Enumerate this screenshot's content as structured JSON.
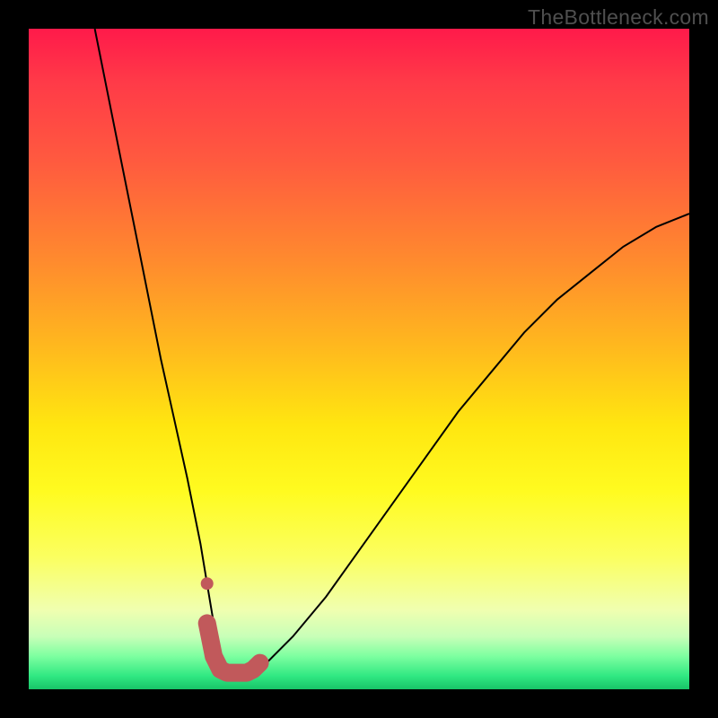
{
  "watermark": "TheBottleneck.com",
  "chart_data": {
    "type": "line",
    "title": "",
    "xlabel": "",
    "ylabel": "",
    "xlim": [
      0,
      100
    ],
    "ylim": [
      0,
      100
    ],
    "series": [
      {
        "name": "black-v-curve",
        "x": [
          10,
          12,
          14,
          16,
          18,
          20,
          22,
          24,
          26,
          27,
          28,
          29,
          30,
          31,
          32,
          34,
          36,
          40,
          45,
          50,
          55,
          60,
          65,
          70,
          75,
          80,
          85,
          90,
          95,
          100
        ],
        "y": [
          100,
          90,
          80,
          70,
          60,
          50,
          41,
          32,
          22,
          16,
          10,
          5,
          2.5,
          2.5,
          2.5,
          2.5,
          4,
          8,
          14,
          21,
          28,
          35,
          42,
          48,
          54,
          59,
          63,
          67,
          70,
          72
        ]
      },
      {
        "name": "red-floor-segment",
        "x": [
          27,
          28,
          29,
          30,
          31,
          32,
          33,
          34,
          35
        ],
        "y": [
          10,
          5,
          3,
          2.5,
          2.5,
          2.5,
          2.5,
          3,
          4
        ]
      }
    ],
    "annotations": [
      {
        "name": "red-dot",
        "x": 27,
        "y": 16
      }
    ],
    "background_gradient": {
      "direction": "vertical",
      "stops": [
        {
          "pos": 0.0,
          "color": "#ff1a4a"
        },
        {
          "pos": 0.35,
          "color": "#ff8a2e"
        },
        {
          "pos": 0.6,
          "color": "#ffe610"
        },
        {
          "pos": 0.88,
          "color": "#f0ffb0"
        },
        {
          "pos": 1.0,
          "color": "#18c468"
        }
      ]
    }
  }
}
